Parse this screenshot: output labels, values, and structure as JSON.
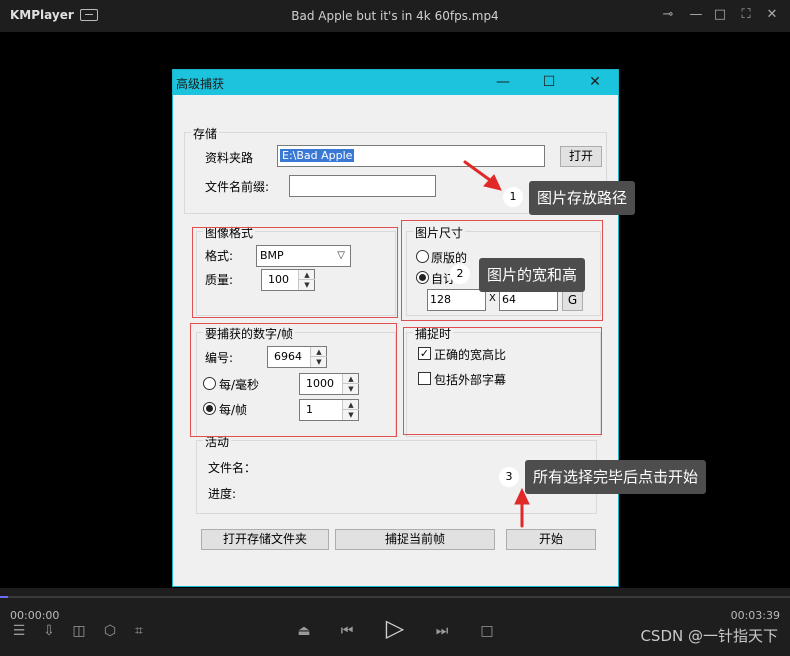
{
  "app": {
    "brand": "KMPlayer",
    "file_title": "Bad Apple but it's in 4k 60fps.mp4"
  },
  "player": {
    "time_current": "00:00:00",
    "time_total": "00:03:39",
    "progress": 0.01,
    "watermark": "CSDN @一针指天下"
  },
  "dialog": {
    "title": "高级捕获",
    "storage": {
      "group_label": "存储",
      "folder_label": "资料夹路",
      "folder_value": "E:\\Bad Apple",
      "open_button": "打开",
      "prefix_label": "文件名前缀:",
      "prefix_value": ""
    },
    "image_format": {
      "group_label": "图像格式",
      "format_label": "格式:",
      "format_value": "BMP",
      "quality_label": "质量:",
      "quality_value": "100"
    },
    "image_size": {
      "group_label": "图片尺寸",
      "original_label": "原版的",
      "custom_label": "自订",
      "width": "128",
      "x_label": "X",
      "height": "64",
      "g_button": "G"
    },
    "frames": {
      "group_label": "要捕获的数字/帧",
      "number_label": "编号:",
      "number_value": "6964",
      "per_ms_label": "每/毫秒",
      "per_ms_value": "1000",
      "per_frame_label": "每/帧",
      "per_frame_value": "1"
    },
    "capture_time": {
      "group_label": "捕捉时",
      "aspect_label": "正确的宽高比",
      "aspect_checked": true,
      "subtitle_label": "包括外部字幕",
      "subtitle_checked": false
    },
    "activity": {
      "group_label": "活动",
      "filename_label": "文件名：",
      "progress_label": "进度:"
    },
    "buttons": {
      "open_folder": "打开存储文件夹",
      "capture_current": "捕捉当前帧",
      "start": "开始"
    }
  },
  "annotations": [
    {
      "number": "1",
      "text": "图片存放路径"
    },
    {
      "number": "2",
      "text": "图片的宽和高"
    },
    {
      "number": "3",
      "text": "所有选择完毕后点击开始"
    }
  ],
  "colors": {
    "dialog_titlebar": "#1cc3dc",
    "highlight_box": "#e05050",
    "seek_fill": "#6b6bff"
  }
}
